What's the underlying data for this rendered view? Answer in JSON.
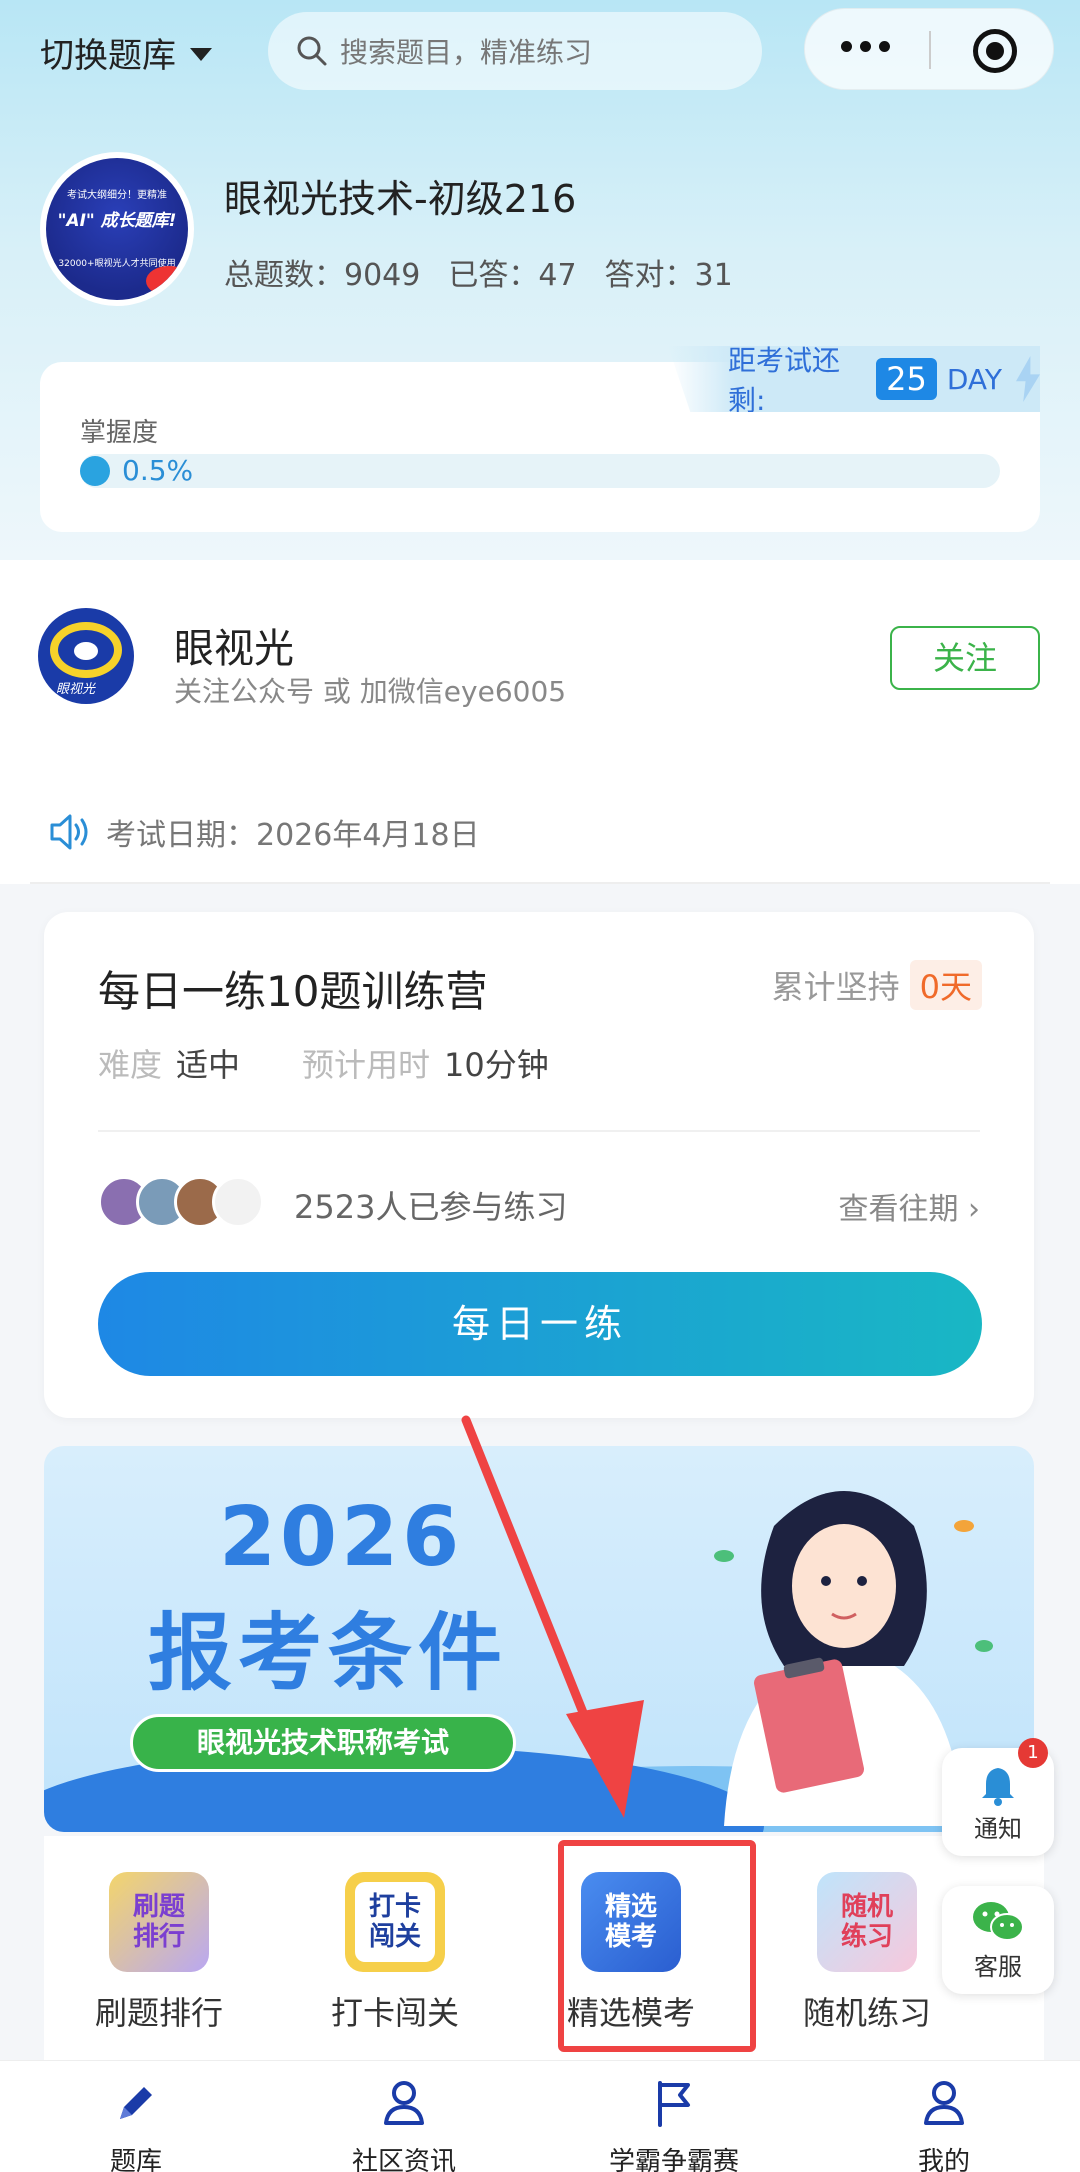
{
  "header": {
    "switch_label": "切换题库",
    "search_placeholder": "搜索题目，精准练习"
  },
  "profile": {
    "logo_line1": "考试大纲细分！更精准",
    "logo_line2": "\"AI\" 成长题库!",
    "logo_line3": "32000+眼视光人才共同使用",
    "title": "眼视光技术-初级216",
    "total_label": "总题数：",
    "total_value": "9049",
    "answered_label": "已答：",
    "answered_value": "47",
    "correct_label": "答对：",
    "correct_value": "31"
  },
  "mastery": {
    "countdown_label": "距考试还剩:",
    "countdown_days": "25",
    "countdown_unit": "DAY",
    "label": "掌握度",
    "percent_text": "0.5%",
    "progress": 0.005
  },
  "follow": {
    "logo_text": "眼视光",
    "name": "眼视光",
    "subtitle": "关注公众号 或 加微信eye6005",
    "button": "关注"
  },
  "notice": {
    "text": "考试日期：2026年4月18日"
  },
  "daily": {
    "title": "每日一练10题训练营",
    "streak_label": "累计坚持",
    "streak_value": "0天",
    "difficulty_label": "难度",
    "difficulty_value": "适中",
    "time_label": "预计用时",
    "time_value": "10分钟",
    "participants": "2523人已参与练习",
    "history_link": "查看往期 ›",
    "cta": "每日一练"
  },
  "banner": {
    "year": "2026",
    "headline": "报考条件",
    "pill": "眼视光技术职称考试"
  },
  "quick_access": [
    {
      "icon_text": "刷题\n排行",
      "label": "刷题排行"
    },
    {
      "icon_text": "打卡\n闯关",
      "label": "打卡闯关"
    },
    {
      "icon_text": "精选\n模考",
      "label": "精选模考"
    },
    {
      "icon_text": "随机\n练习",
      "label": "随机练习"
    }
  ],
  "floating": {
    "notify_label": "通知",
    "notify_badge": "1",
    "service_label": "客服"
  },
  "tabs": [
    {
      "label": "题库",
      "icon": "pencil-icon"
    },
    {
      "label": "社区资讯",
      "icon": "people-icon"
    },
    {
      "label": "学霸争霸赛",
      "icon": "flag-icon"
    },
    {
      "label": "我的",
      "icon": "person-icon"
    }
  ],
  "colors": {
    "brand_blue": "#1e88e5",
    "follow_green": "#3bb34a",
    "highlight_red": "#ef4343",
    "streak_orange": "#f06a2a"
  }
}
